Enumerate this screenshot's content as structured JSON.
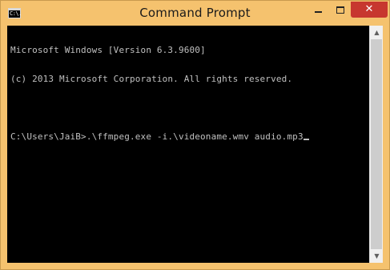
{
  "window": {
    "title": "Command Prompt",
    "icon_label": "C:\\.",
    "controls": {
      "minimize": "minimize-icon",
      "maximize": "maximize-icon",
      "close_glyph": "✕"
    }
  },
  "console": {
    "lines": [
      "Microsoft Windows [Version 6.3.9600]",
      "(c) 2013 Microsoft Corporation. All rights reserved.",
      "",
      "C:\\Users\\JaiB>.\\ffmpeg.exe -i.\\videoname.wmv audio.mp3"
    ]
  },
  "scrollbar": {
    "up_glyph": "▲",
    "down_glyph": "▼"
  },
  "colors": {
    "titlebar": "#f5c26e",
    "console_bg": "#000000",
    "console_fg": "#c0c0c0",
    "close_button": "#c7372f"
  }
}
